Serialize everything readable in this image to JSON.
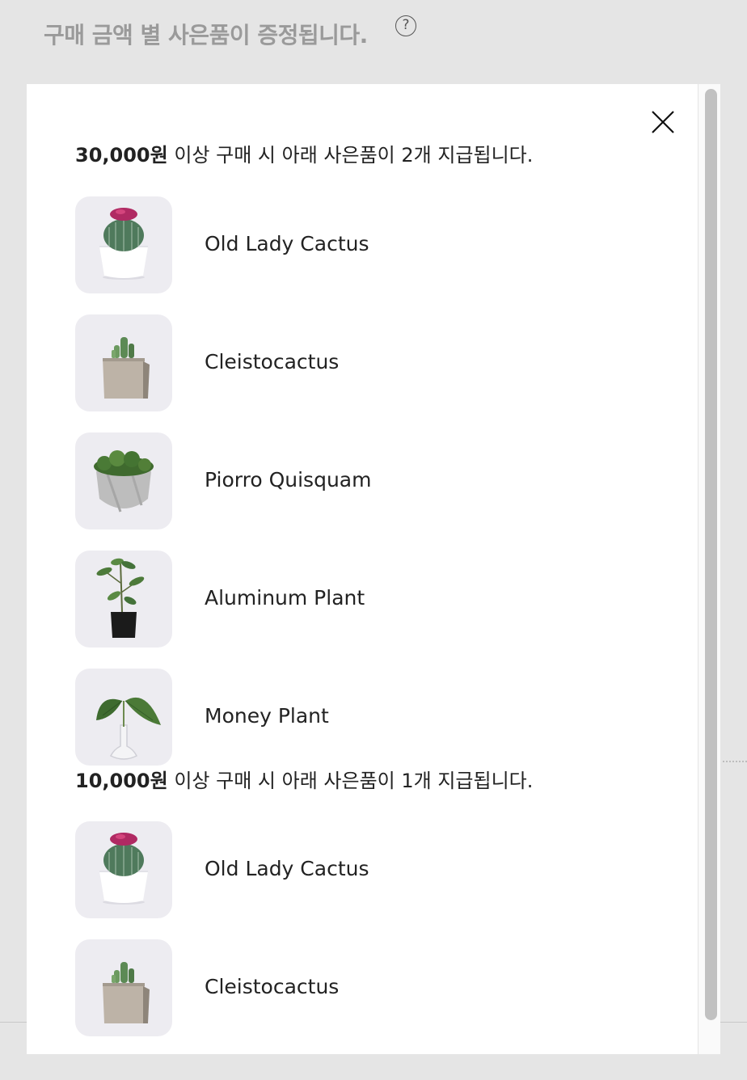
{
  "page": {
    "header_title": "구매 금액 별 사은품이 증정됩니다.",
    "help_glyph": "?"
  },
  "modal": {
    "tiers": [
      {
        "amount": "30,000원",
        "description": " 이상 구매 시 아래 사은품이 2개 지급됩니다.",
        "gifts": [
          {
            "name": "Old Lady Cactus",
            "icon": "cactus-white-pot"
          },
          {
            "name": "Cleistocactus",
            "icon": "cactus-square-pot"
          },
          {
            "name": "Piorro Quisquam",
            "icon": "moss-stone-pot"
          },
          {
            "name": "Aluminum Plant",
            "icon": "plant-black-bag"
          },
          {
            "name": "Money Plant",
            "icon": "leaf-glass-vase"
          }
        ]
      },
      {
        "amount": "10,000원",
        "description": " 이상 구매 시 아래 사은품이 1개 지급됩니다.",
        "gifts": [
          {
            "name": "Old Lady Cactus",
            "icon": "cactus-white-pot"
          },
          {
            "name": "Cleistocactus",
            "icon": "cactus-square-pot"
          }
        ]
      }
    ]
  },
  "colors": {
    "backdrop": "#e5e5e5",
    "modal_bg": "#ffffff",
    "thumb_bg": "#edecf1",
    "scroll_thumb": "#c1c1c1"
  }
}
